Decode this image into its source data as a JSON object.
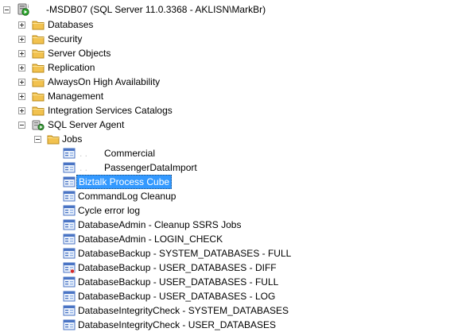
{
  "server": {
    "label": "-MSDB07 (SQL Server 11.0.3368 - AKLISN\\MarkBr)",
    "icon": "server-running-icon"
  },
  "nodes": [
    {
      "label": "Databases",
      "expanded": false
    },
    {
      "label": "Security",
      "expanded": false
    },
    {
      "label": "Server Objects",
      "expanded": false
    },
    {
      "label": "Replication",
      "expanded": false
    },
    {
      "label": "AlwaysOn High Availability",
      "expanded": false
    },
    {
      "label": "Management",
      "expanded": false
    },
    {
      "label": "Integration Services Catalogs",
      "expanded": false
    }
  ],
  "agent": {
    "label": "SQL Server Agent",
    "expanded": true
  },
  "jobs_folder": {
    "label": "Jobs",
    "expanded": true
  },
  "jobs": [
    {
      "prefix": ". .",
      "label": "Commercial",
      "selected": false,
      "icon": "job-icon"
    },
    {
      "prefix": ".  .",
      "label": "PassengerDataImport",
      "selected": false,
      "icon": "job-icon"
    },
    {
      "prefix": "",
      "label": "Biztalk Process Cube",
      "selected": true,
      "icon": "job-icon"
    },
    {
      "prefix": "",
      "label": "CommandLog Cleanup",
      "selected": false,
      "icon": "job-icon"
    },
    {
      "prefix": "",
      "label": "Cycle error log",
      "selected": false,
      "icon": "job-icon"
    },
    {
      "prefix": "",
      "label": "DatabaseAdmin - Cleanup SSRS Jobs",
      "selected": false,
      "icon": "job-icon"
    },
    {
      "prefix": "",
      "label": "DatabaseAdmin - LOGIN_CHECK",
      "selected": false,
      "icon": "job-icon"
    },
    {
      "prefix": "",
      "label": "DatabaseBackup - SYSTEM_DATABASES - FULL",
      "selected": false,
      "icon": "job-icon"
    },
    {
      "prefix": "",
      "label": "DatabaseBackup - USER_DATABASES - DIFF",
      "selected": false,
      "icon": "job-failed-icon"
    },
    {
      "prefix": "",
      "label": "DatabaseBackup - USER_DATABASES - FULL",
      "selected": false,
      "icon": "job-icon"
    },
    {
      "prefix": "",
      "label": "DatabaseBackup - USER_DATABASES - LOG",
      "selected": false,
      "icon": "job-icon"
    },
    {
      "prefix": "",
      "label": "DatabaseIntegrityCheck - SYSTEM_DATABASES",
      "selected": false,
      "icon": "job-icon"
    },
    {
      "prefix": "",
      "label": "DatabaseIntegrityCheck - USER_DATABASES",
      "selected": false,
      "icon": "job-icon"
    }
  ],
  "colors": {
    "selection": "#3399ff",
    "folder": "#f2c24f",
    "job_icon": "#4a74c4"
  }
}
